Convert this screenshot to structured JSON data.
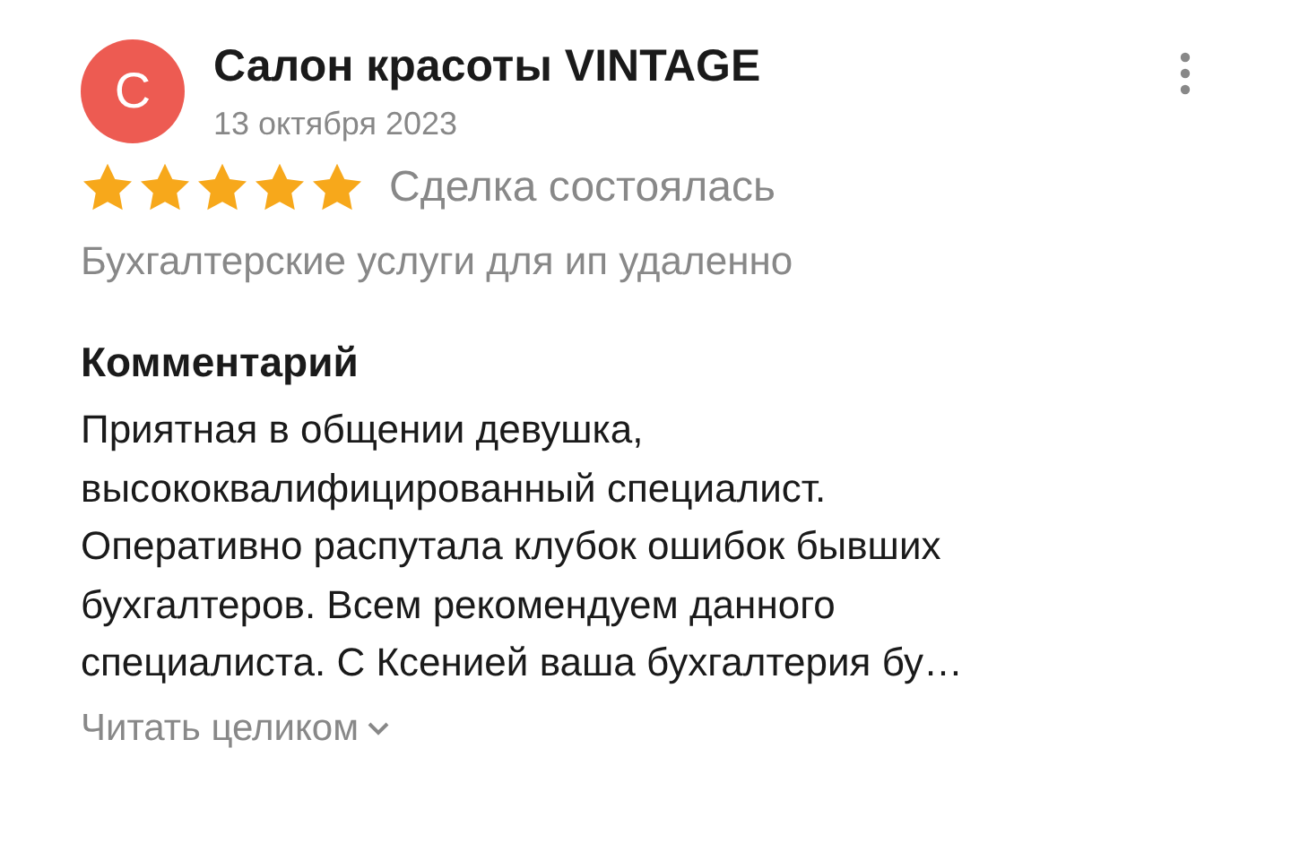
{
  "review": {
    "avatar_letter": "С",
    "author": "Салон красоты VINTAGE",
    "date": "13 октября 2023",
    "stars": 5,
    "deal_status": "Сделка состоялась",
    "service": "Бухгалтерские услуги для ип удаленно",
    "comment_heading": "Комментарий",
    "comment": "Приятная в общении девушка,\nвысококвалифицированный специалист.\nОперативно распутала клубок ошибок бывших\nбухгалтеров. Всем рекомендуем данного\nспециалиста. С Ксенией ваша бухгалтерия бу…",
    "read_more": "Читать целиком"
  }
}
